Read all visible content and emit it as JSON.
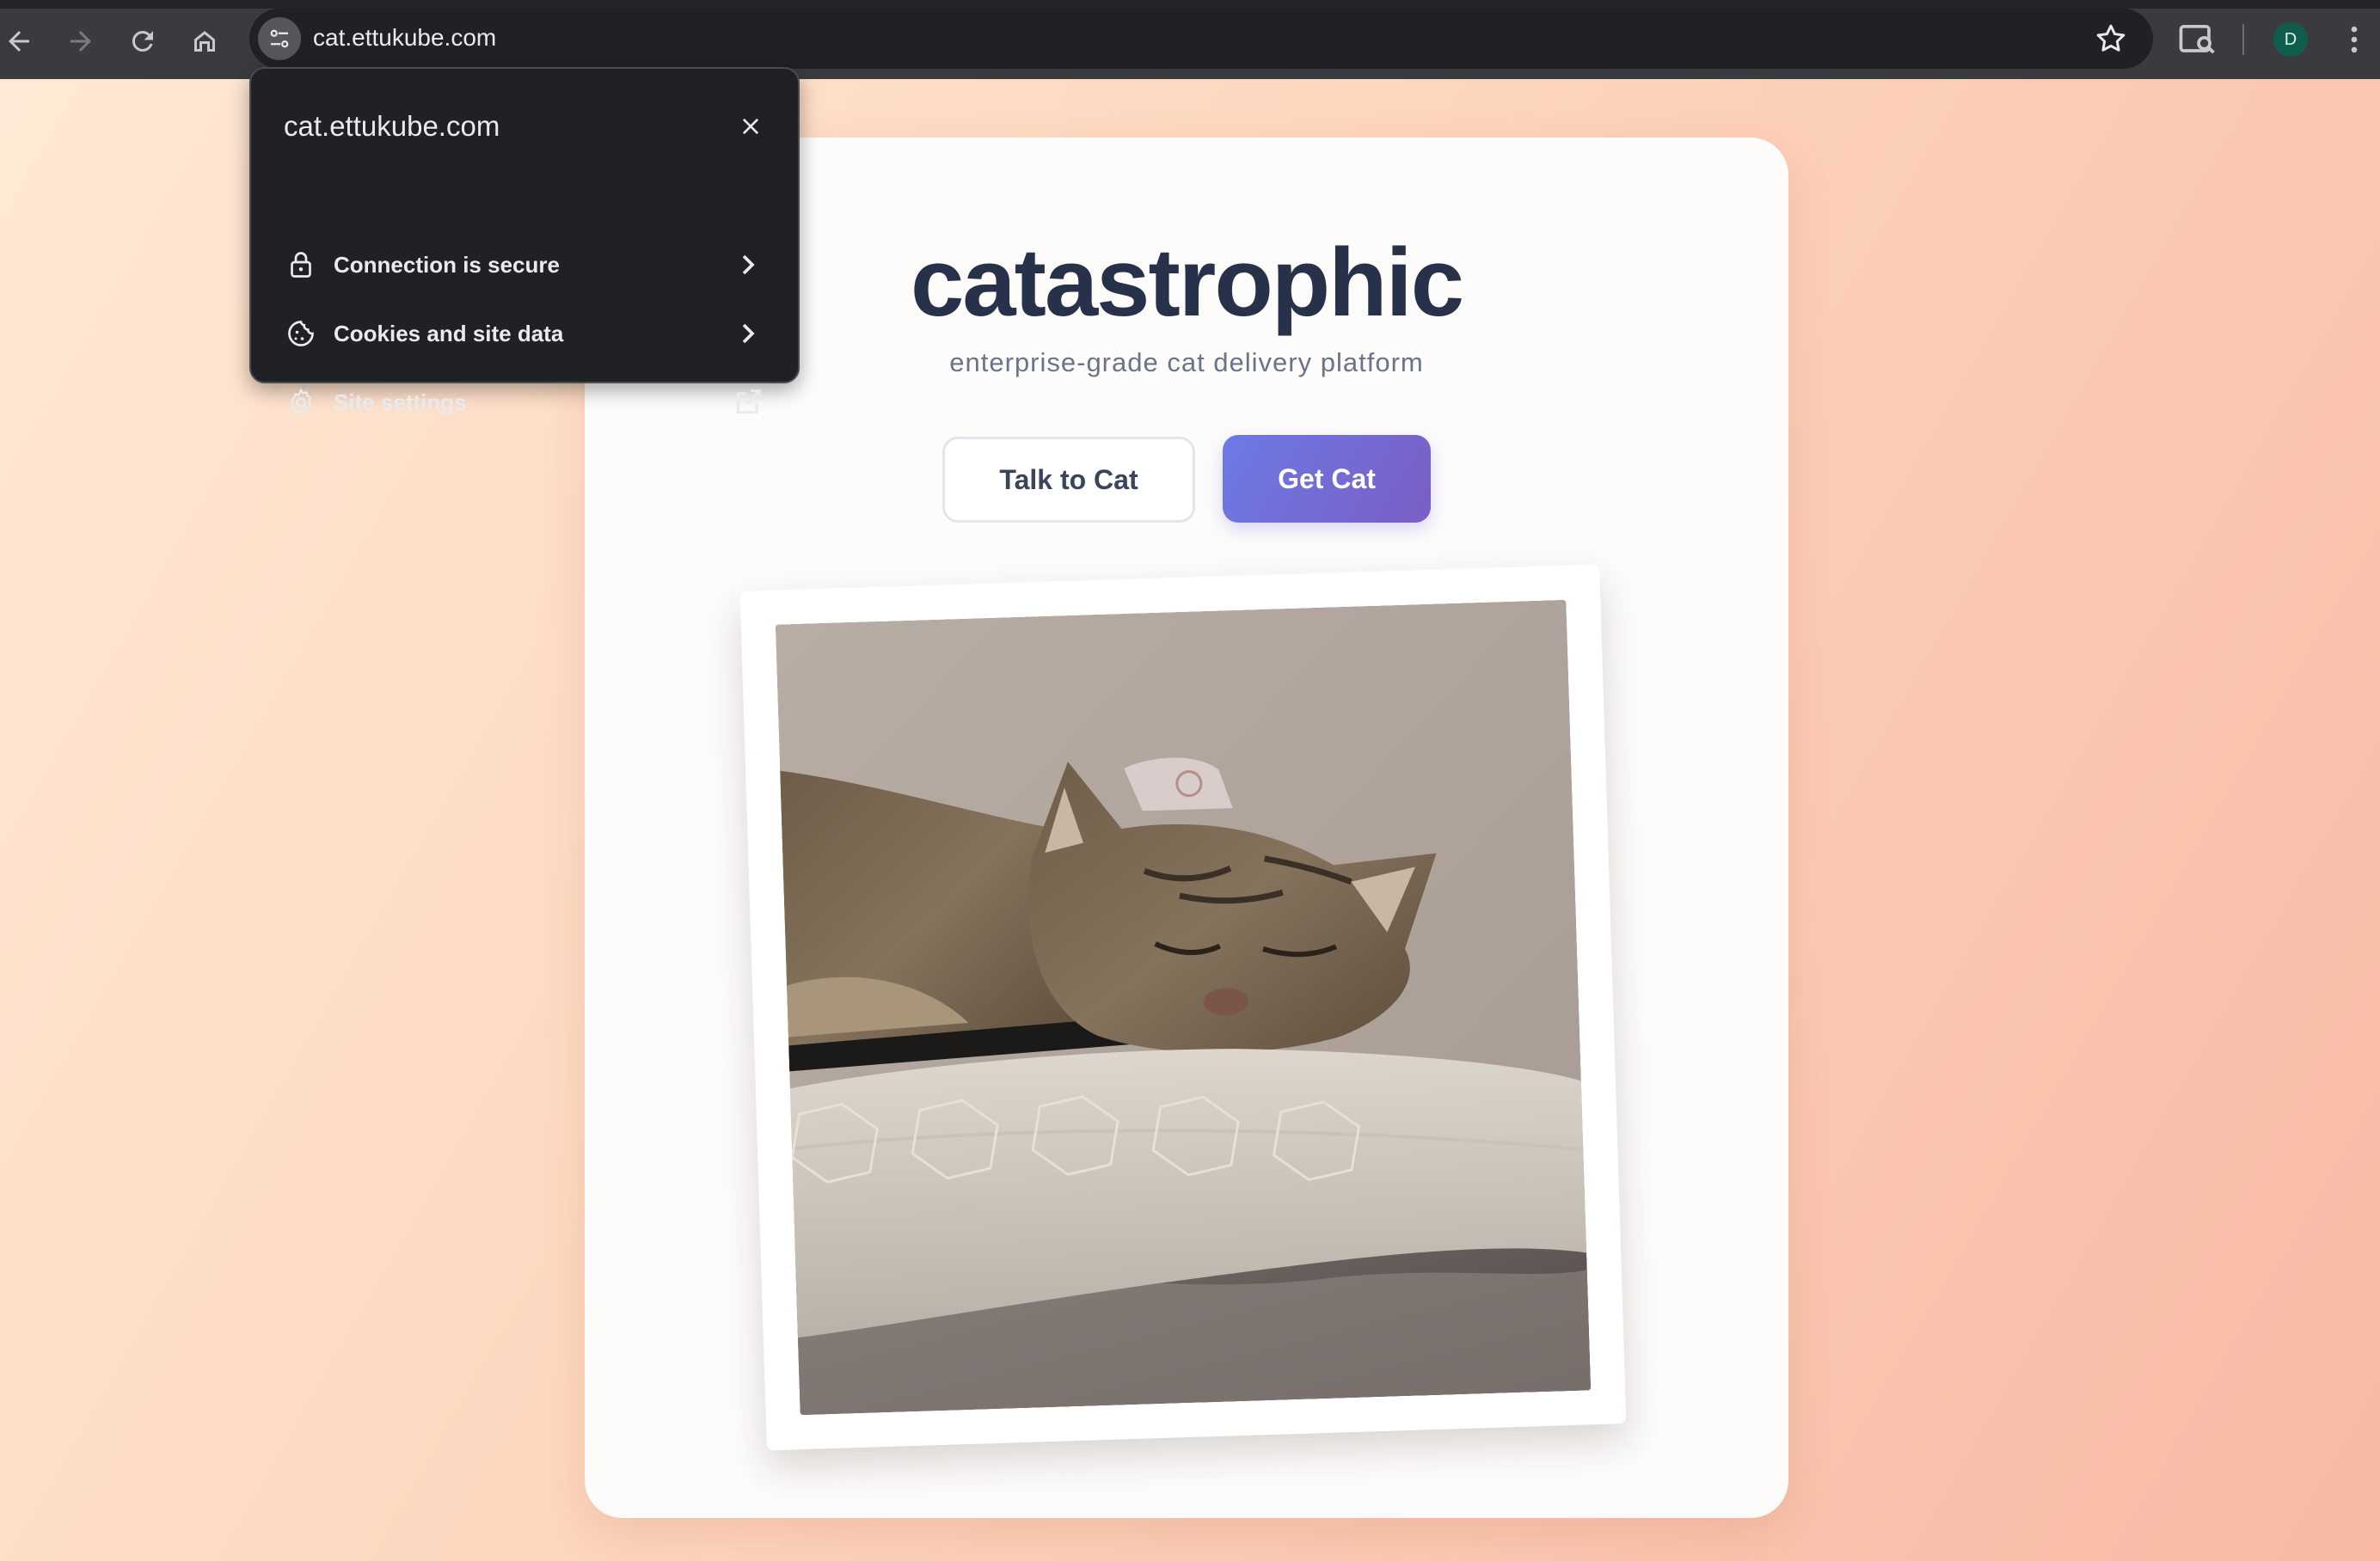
{
  "browser": {
    "url": "cat.ettukube.com",
    "profile_initial": "D",
    "icons": {
      "back": "arrow-left-icon",
      "forward": "arrow-right-icon",
      "reload": "reload-icon",
      "home": "home-icon",
      "site_info": "tune-icon",
      "bookmark": "star-icon",
      "lens": "search-page-icon",
      "menu": "kebab-menu-icon"
    }
  },
  "site_info_popup": {
    "title": "cat.ettukube.com",
    "items": [
      {
        "label": "Connection is secure",
        "icon": "lock-icon",
        "action_icon": "chevron-right-icon"
      },
      {
        "label": "Cookies and site data",
        "icon": "cookie-icon",
        "action_icon": "chevron-right-icon"
      },
      {
        "label": "Site settings",
        "icon": "gear-icon",
        "action_icon": "open-in-new-icon"
      }
    ]
  },
  "page": {
    "title": "catastrophic",
    "tagline": "enterprise-grade cat delivery platform",
    "buttons": {
      "talk": "Talk to Cat",
      "get": "Get Cat"
    },
    "photo": {
      "subject": "sleeping tabby cat on a pillow"
    },
    "colors": {
      "title": "#27324a",
      "accent_start": "#6d7ae6",
      "accent_end": "#7a5ec4",
      "background_start": "#ffe9d6",
      "background_end": "#f7b9a4"
    }
  }
}
